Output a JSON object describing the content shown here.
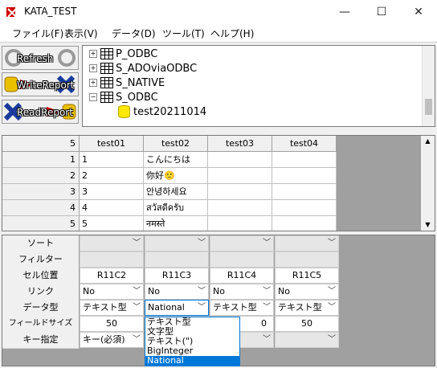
{
  "window": {
    "title": "KATA_TEST",
    "minimize": "—",
    "maximize": "☐",
    "close": "✕"
  },
  "menu": [
    "ファイル(F)",
    "表示(V)",
    "データ(D)",
    "ツール(T)",
    "ヘルプ(H)"
  ],
  "toolbar": {
    "refresh": "Refresh",
    "write": "WriteReport",
    "read": "ReadReport"
  },
  "tree": [
    {
      "label": "P_ODBC",
      "expander": "+"
    },
    {
      "label": "S_ADOviaODBC",
      "expander": "+"
    },
    {
      "label": "S_NATIVE",
      "expander": "+"
    },
    {
      "label": "S_ODBC",
      "expander": "−"
    },
    {
      "label": "test20211014",
      "expander": ""
    }
  ],
  "grid": {
    "corner": "5",
    "columns": [
      "test01",
      "test02",
      "test03",
      "test04"
    ],
    "rows": [
      {
        "num": "1",
        "cells": [
          "1",
          "こんにちは",
          "",
          ""
        ]
      },
      {
        "num": "2",
        "cells": [
          "2",
          "你好🙂",
          "",
          ""
        ]
      },
      {
        "num": "3",
        "cells": [
          "3",
          "안녕하세요",
          "",
          ""
        ]
      },
      {
        "num": "4",
        "cells": [
          "4",
          "สวัสดีครับ",
          "",
          ""
        ]
      },
      {
        "num": "5",
        "cells": [
          "5",
          "नमस्ते",
          "",
          ""
        ]
      }
    ]
  },
  "settings": {
    "labels": [
      "ソート",
      "フィルター",
      "セル位置",
      "リンク",
      "データ型",
      "フィールドサイズ",
      "キー指定"
    ],
    "cell_positions": [
      "R11C2",
      "R11C3",
      "R11C4",
      "R11C5"
    ],
    "links": [
      "No",
      "No",
      "No",
      "No"
    ],
    "types": [
      "テキスト型",
      "National",
      "テキスト型",
      "テキスト型"
    ],
    "sizes": [
      "50",
      "",
      "0",
      "50"
    ],
    "key": "キー(必須)"
  },
  "dropdown": {
    "options": [
      "テキスト型",
      "文字型",
      "テキスト(\")",
      "BigInteger",
      "National"
    ],
    "selected": "National"
  }
}
